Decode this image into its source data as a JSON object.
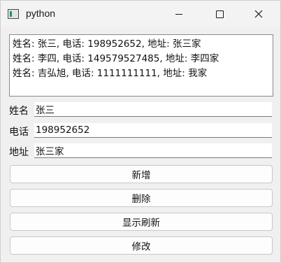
{
  "window": {
    "title": "python"
  },
  "list": {
    "items": [
      "姓名: 张三, 电话: 198952652, 地址: 张三家",
      "姓名: 李四, 电话: 149579527485, 地址: 李四家",
      "姓名: 吉弘旭, 电话: 1111111111, 地址: 我家"
    ]
  },
  "form": {
    "name_label": "姓名",
    "name_value": "张三",
    "phone_label": "电话",
    "phone_value": "198952652",
    "address_label": "地址",
    "address_value": "张三家"
  },
  "buttons": {
    "add": "新增",
    "delete": "删除",
    "refresh": "显示刷新",
    "edit": "修改"
  }
}
